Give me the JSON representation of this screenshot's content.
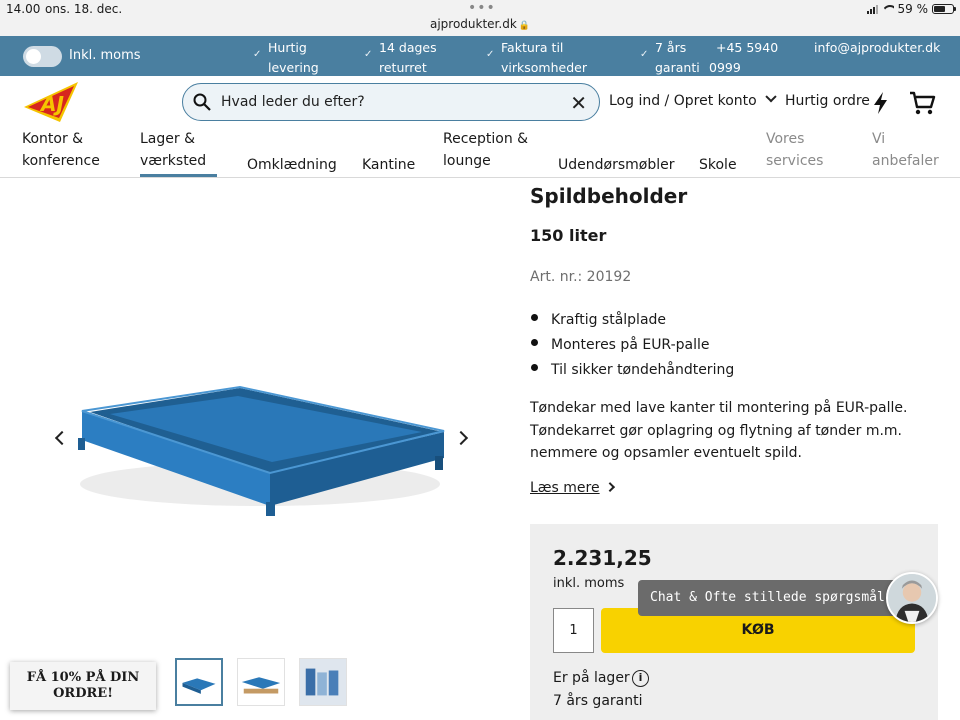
{
  "status_bar": {
    "time": "14.00",
    "date": "ons. 18. dec.",
    "url": "ajprodukter.dk",
    "battery": "59 %",
    "battery_level": 0.59
  },
  "info_bar": {
    "toggle_label": "Inkl. moms",
    "toggle_on": true,
    "usps": [
      {
        "line1": "Hurtig",
        "line2": "levering"
      },
      {
        "line1": "14 dages",
        "line2": "returret"
      },
      {
        "line1": "Faktura til",
        "line2": "virksomheder"
      },
      {
        "line1": "7 års",
        "line2": "garanti"
      }
    ],
    "phone_line1": "+45 5940",
    "phone_line2": "0999",
    "email": "info@ajprodukter.dk"
  },
  "header": {
    "logo_text": "AJ",
    "search_placeholder": "Hvad leder du efter?",
    "login_label": "Log ind / Opret konto",
    "quick_order_label": "Hurtig ordre"
  },
  "nav": {
    "items": [
      {
        "line1": "Kontor &",
        "line2": "konference"
      },
      {
        "line1": "Lager &",
        "line2": "værksted"
      },
      {
        "line1": "Omklædning"
      },
      {
        "line1": "Kantine"
      },
      {
        "line1": "Reception &",
        "line2": "lounge"
      },
      {
        "line1": "Udendørsmøbler"
      },
      {
        "line1": "Skole"
      },
      {
        "line1": "Vores",
        "line2": "services"
      },
      {
        "line1": "Vi",
        "line2": "anbefaler"
      }
    ]
  },
  "product": {
    "title": "Spildbeholder",
    "subtitle": "150 liter",
    "art_nr": "Art. nr.: 20192",
    "bullets": [
      "Kraftig stålplade",
      "Monteres på EUR-palle",
      "Til sikker tøndehåndtering"
    ],
    "description": "Tøndekar med lave kanter til montering på EUR-palle. Tøndekarret gør oplagring og flytning af tønder m.m. nemmere og opsamler eventuelt spild.",
    "read_more": "Læs mere",
    "color": "#2a78b8"
  },
  "buy_box": {
    "price": "2.231,25",
    "vat_note": "inkl. moms",
    "quantity": "1",
    "buy_label": "KØB",
    "stock": "Er på lager",
    "warranty": "7 års garanti"
  },
  "promo": {
    "line1": "FÅ 10% PÅ DIN",
    "line2": "ORDRE!"
  },
  "chat": {
    "label": "Chat & Ofte stillede spørgsmål"
  },
  "colors": {
    "brand_blue": "#4a7fa0",
    "buy_yellow": "#f8d200",
    "logo_yellow": "#f5c400",
    "logo_red": "#d7261e"
  }
}
